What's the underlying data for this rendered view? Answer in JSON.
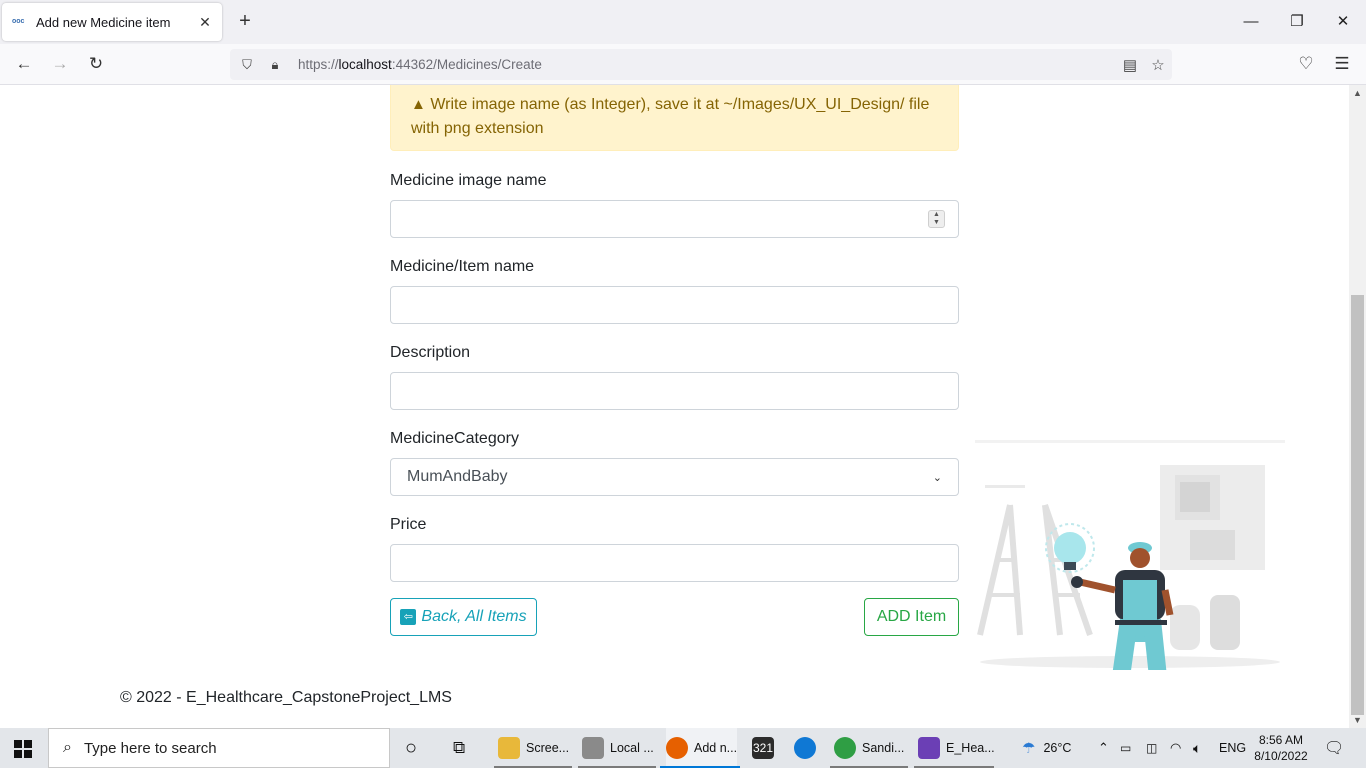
{
  "browser": {
    "tab_title": "Add new Medicine item",
    "url_prefix": "https://",
    "url_host": "localhost",
    "url_rest": ":44362/Medicines/Create"
  },
  "page": {
    "alert_text": "Write image name (as Integer), save it at ~/Images/UX_UI_Design/ file with png extension",
    "fields": {
      "image_name_label": "Medicine image name",
      "image_name_value": "",
      "item_name_label": "Medicine/Item name",
      "item_name_value": "",
      "description_label": "Description",
      "description_value": "",
      "category_label": "MedicineCategory",
      "category_value": "MumAndBaby",
      "price_label": "Price",
      "price_value": ""
    },
    "back_button": "Back, All Items",
    "add_button": "ADD Item",
    "footer": "© 2022 - E_Healthcare_CapstoneProject_LMS"
  },
  "taskbar": {
    "search_placeholder": "Type here to search",
    "apps": [
      {
        "label": "Scree...",
        "color": "#e8b83a"
      },
      {
        "label": "Local ...",
        "color": "#8a8a8a"
      },
      {
        "label": "Add n...",
        "color": "#e66000"
      },
      {
        "label": "",
        "color": "#2b2b2b"
      },
      {
        "label": "",
        "color": "#0f78d4"
      },
      {
        "label": "Sandi...",
        "color": "#2f9e44"
      },
      {
        "label": "E_Hea...",
        "color": "#6b3fb5"
      }
    ],
    "weather": "26°C",
    "language": "ENG",
    "time": "8:56 AM",
    "date": "8/10/2022"
  },
  "colors": {
    "info": "#17a2b8",
    "success": "#28a745",
    "warning_bg": "#fff3cd",
    "warning_text": "#856404"
  }
}
